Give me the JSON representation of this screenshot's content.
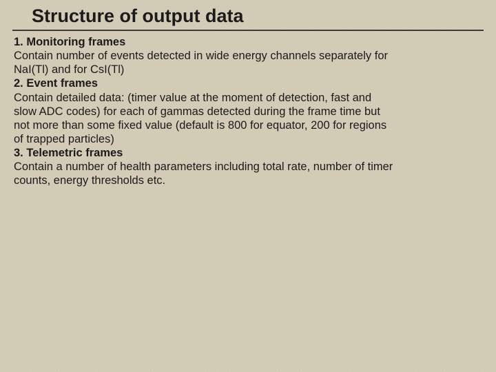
{
  "title": "Structure of output data",
  "sections": [
    {
      "heading": "1. Monitoring frames",
      "lines": [
        "Contain number of events detected in wide energy channels separately for",
        "NaI(Tl) and for CsI(Tl)"
      ]
    },
    {
      "heading": "2. Event frames",
      "lines": [
        "Contain  detailed data: (timer value at the moment of detection,  fast and",
        "slow ADC codes) for each of  gammas detected during the frame time but",
        "not more than some fixed value (default is 800 for equator, 200 for regions",
        "of trapped particles)"
      ]
    },
    {
      "heading": "3. Telemetric frames",
      "lines": [
        "Contain a number of health parameters including total rate, number of timer",
        "counts, energy thresholds etc."
      ]
    }
  ]
}
